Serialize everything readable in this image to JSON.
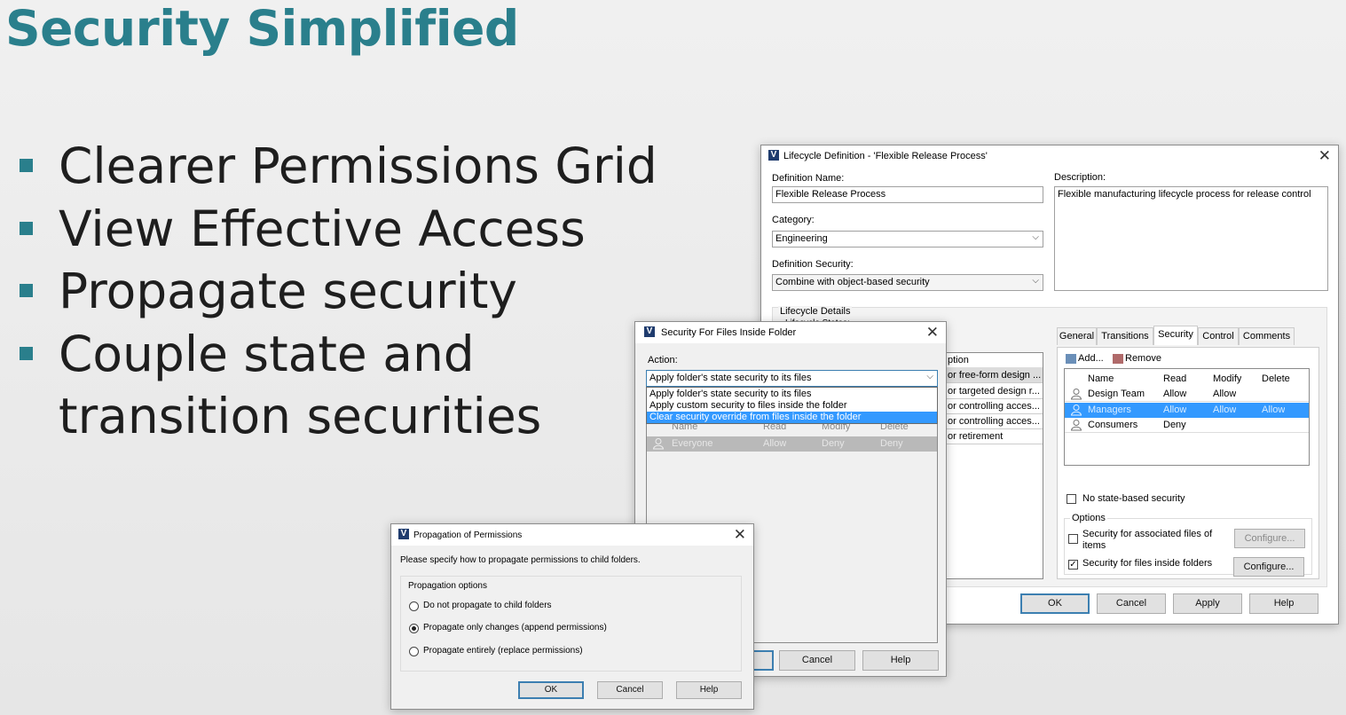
{
  "slide": {
    "title": "Security Simplified",
    "bullets": [
      "Clearer Permissions Grid",
      "View Effective Access",
      "Propagate security",
      "Couple state and",
      "transition securities"
    ],
    "accent_color": "#2a7f8c"
  },
  "lifecycle": {
    "title": "Lifecycle Definition - 'Flexible Release Process'",
    "definition_name_label": "Definition Name:",
    "definition_name_value": "Flexible Release Process",
    "description_label": "Description:",
    "description_value": "Flexible manufacturing lifecycle process for release control",
    "category_label": "Category:",
    "category_value": "Engineering",
    "definition_security_label": "Definition Security:",
    "definition_security_value": "Combine with object-based security",
    "lifecycle_details_label": "Lifecycle Details",
    "lifecycle_states_label": "Lifecycle States:",
    "desc_column_partial": "ption",
    "state_descriptions": [
      "or free-form design ...",
      "or targeted design r...",
      "or controlling acces...",
      "or controlling acces...",
      "or retirement"
    ],
    "tabs": [
      "General",
      "Transitions",
      "Security",
      "Control",
      "Comments"
    ],
    "add_label": "Add...",
    "remove_label": "Remove",
    "grid_headers": [
      "Name",
      "Read",
      "Modify",
      "Delete"
    ],
    "grid_rows": [
      {
        "name": "Design Team",
        "read": "Allow",
        "modify": "Allow",
        "delete": ""
      },
      {
        "name": "Managers",
        "read": "Allow",
        "modify": "Allow",
        "delete": "Allow"
      },
      {
        "name": "Consumers",
        "read": "Deny",
        "modify": "",
        "delete": ""
      }
    ],
    "no_state_security_label": "No state-based security",
    "options_label": "Options",
    "assoc_files_label_1": "Security for associated files of",
    "assoc_files_label_2": "items",
    "files_inside_label": "Security for files inside folders",
    "configure_label": "Configure...",
    "ok_label": "OK",
    "cancel_label": "Cancel",
    "apply_label": "Apply",
    "help_label": "Help"
  },
  "folder_security": {
    "title": "Security For Files Inside Folder",
    "action_label": "Action:",
    "action_value": "Apply folder's state security to its files",
    "options": [
      "Apply folder's state security to its files",
      "Apply custom security to files inside the folder",
      "Clear security override from files inside the folder"
    ],
    "grid_headers": [
      "Name",
      "Read",
      "Modify",
      "Delete"
    ],
    "grid_row": {
      "name": "Everyone",
      "read": "Allow",
      "modify": "Deny",
      "delete": "Deny"
    },
    "cancel_label": "Cancel",
    "help_label": "Help"
  },
  "propagation": {
    "title": "Propagation of Permissions",
    "instruction": "Please specify how to propagate permissions to child folders.",
    "group_label": "Propagation options",
    "options": [
      "Do not propagate to child folders",
      "Propagate only changes (append permissions)",
      "Propagate entirely (replace permissions)"
    ],
    "ok_label": "OK",
    "cancel_label": "Cancel",
    "help_label": "Help"
  }
}
